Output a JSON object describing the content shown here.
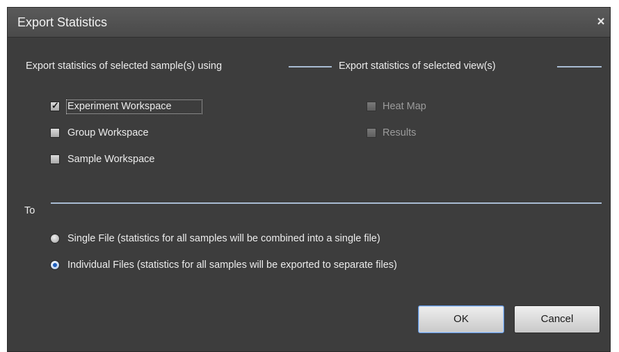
{
  "dialog": {
    "title": "Export Statistics",
    "close_glyph": "×"
  },
  "samples_section": {
    "header": "Export statistics of selected sample(s) using",
    "options": [
      {
        "label": "Experiment Workspace",
        "checked": true,
        "enabled": true
      },
      {
        "label": "Group Workspace",
        "checked": false,
        "enabled": true
      },
      {
        "label": "Sample Workspace",
        "checked": false,
        "enabled": true
      }
    ]
  },
  "views_section": {
    "header": "Export statistics of selected view(s)",
    "options": [
      {
        "label": "Heat Map",
        "checked": false,
        "enabled": false
      },
      {
        "label": "Results",
        "checked": false,
        "enabled": false
      }
    ]
  },
  "to_section": {
    "header": "To",
    "options": [
      {
        "label": "Single File (statistics for all samples will be combined into a single file)",
        "selected": false
      },
      {
        "label": "Individual Files (statistics for all samples will be exported to separate files)",
        "selected": true
      }
    ]
  },
  "buttons": {
    "ok": "OK",
    "cancel": "Cancel"
  },
  "colors": {
    "dialog_bg": "#3d3d3d",
    "rule": "#a9bcd3",
    "accent": "#1e5fbf"
  }
}
